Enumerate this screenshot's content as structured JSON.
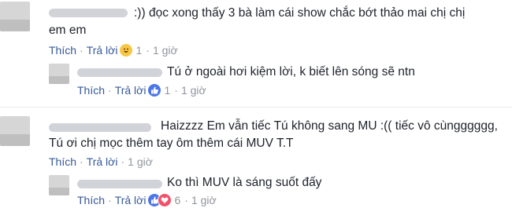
{
  "comments": [
    {
      "text_line1": "đọc xong thấy 3 bà làm cái show chắc bớt thảo mai chị chị",
      "text_line2": "em em",
      "prefix": ":))",
      "like_label": "Thích",
      "reply_label": "Trả lời",
      "reaction_count": "1",
      "time": "1 giờ",
      "reply": {
        "text": "Tú ở ngoài hơi kiệm lời, k biết lên sóng sẽ ntn",
        "like_label": "Thích",
        "reply_label": "Trả lời",
        "reaction_count": "1",
        "time": "1 giờ"
      }
    },
    {
      "text_line1": "Haizzzz Em vẫn tiếc Tú không sang MU :(( tiếc vô cùngggggg,",
      "text_line2": "Tú ơi chị mọc thêm tay ôm thêm cái MUV T.T",
      "like_label": "Thích",
      "reply_label": "Trả lời",
      "time": "1 giờ",
      "reply": {
        "text": "Ko thì MUV là sáng suốt đấy",
        "like_label": "Thích",
        "reply_label": "Trả lời",
        "reaction_count": "6",
        "time": "1 giờ"
      }
    }
  ],
  "separator": "·",
  "colors": {
    "link": "#365899",
    "meta": "#90949c",
    "text": "#1d2129",
    "like": "#4a76e8",
    "love": "#f25268",
    "haha": "#f7c646"
  },
  "icons": {
    "haha": "haha-reaction-icon",
    "like": "like-reaction-icon",
    "love": "love-reaction-icon"
  }
}
